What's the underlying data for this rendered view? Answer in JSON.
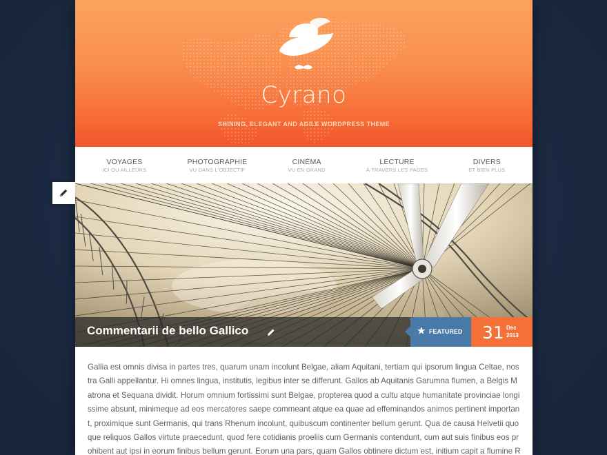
{
  "site": {
    "title": "Cyrano",
    "description": "SHINING, ELEGANT AND AGILE WORDPRESS THEME",
    "colors": {
      "header_top": "#fba25f",
      "header_bottom": "#f2552c",
      "background": "#1b2a42"
    }
  },
  "nav": {
    "items": [
      {
        "label": "VOYAGES",
        "sub": "ICI OU AILLEURS"
      },
      {
        "label": "PHOTOGRAPHIE",
        "sub": "VU DANS L'OBJECTIF"
      },
      {
        "label": "CINÉMA",
        "sub": "VU EN GRAND"
      },
      {
        "label": "LECTURE",
        "sub": "À TRAVERS LES PAGES"
      },
      {
        "label": "DIVERS",
        "sub": "ET BIEN PLUS"
      }
    ]
  },
  "post": {
    "title": "Commentarii de bello Gallico",
    "featured_label": "FEATURED",
    "date": {
      "day": "31",
      "month": "Dec",
      "year": "2013"
    },
    "colors": {
      "featured": "#4a7aa8",
      "date": "#f4713a"
    },
    "body": "Gallia est omnis divisa in partes tres, quarum unam incolunt Belgae, aliam Aquitani, tertiam qui ipsorum lingua Celtae, nostra Galli appellantur. Hi omnes lingua, institutis, legibus inter se differunt. Gallos ab Aquitanis Garumna flumen, a Belgis Matrona et Sequana dividit. Horum omnium fortissimi sunt Belgae, propterea quod a cultu atque humanitate provinciae longissime absunt, minimeque ad eos mercatores saepe commeant atque ea quae ad effeminandos animos pertinent important, proximique sunt Germanis, qui trans Rhenum incolunt, quibuscum continenter bellum gerunt. Qua de causa Helvetii quoque reliquos Gallos virtute praecedunt, quod fere cotidianis proeliis cum Germanis contendunt, cum aut suis finibus eos prohibent aut ipsi in eorum finibus bellum gerunt. Eorum una pars, quam Gallos obtinere dictum est, initium capit a flumine Rhodano."
  },
  "icons": {
    "edit": "pencil-icon",
    "featured": "star-icon",
    "logo": "hat-mustache-logo"
  }
}
